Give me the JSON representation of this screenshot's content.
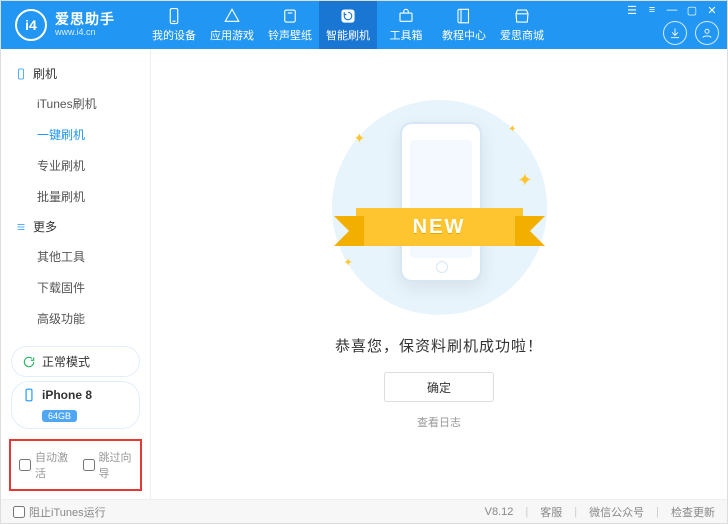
{
  "header": {
    "brand": "爱思助手",
    "url": "www.i4.cn",
    "nav": [
      {
        "key": "device",
        "label": "我的设备"
      },
      {
        "key": "apps",
        "label": "应用游戏"
      },
      {
        "key": "ring",
        "label": "铃声壁纸"
      },
      {
        "key": "flash",
        "label": "智能刷机"
      },
      {
        "key": "tools",
        "label": "工具箱"
      },
      {
        "key": "tutorial",
        "label": "教程中心"
      },
      {
        "key": "mall",
        "label": "爱思商城"
      }
    ],
    "active_nav": "flash"
  },
  "sidebar": {
    "group_flash": "刷机",
    "group_more": "更多",
    "items_flash": [
      {
        "key": "itunes-flash",
        "label": "iTunes刷机"
      },
      {
        "key": "oneclick-flash",
        "label": "一键刷机"
      },
      {
        "key": "pro-flash",
        "label": "专业刷机"
      },
      {
        "key": "batch-flash",
        "label": "批量刷机"
      }
    ],
    "items_more": [
      {
        "key": "other-tools",
        "label": "其他工具"
      },
      {
        "key": "download-fw",
        "label": "下载固件"
      },
      {
        "key": "advanced",
        "label": "高级功能"
      }
    ],
    "active_item": "oneclick-flash",
    "mode_label": "正常模式",
    "device_name": "iPhone 8",
    "device_badge": "64GB",
    "chk_auto_label": "自动激活",
    "chk_skip_label": "跳过向导"
  },
  "content": {
    "banner_text": "NEW",
    "success_msg": "恭喜您，保资料刷机成功啦！",
    "ok_label": "确定",
    "log_label": "查看日志"
  },
  "footer": {
    "block_itunes": "阻止iTunes运行",
    "version": "V8.12",
    "support": "客服",
    "wechat": "微信公众号",
    "update": "检查更新"
  }
}
